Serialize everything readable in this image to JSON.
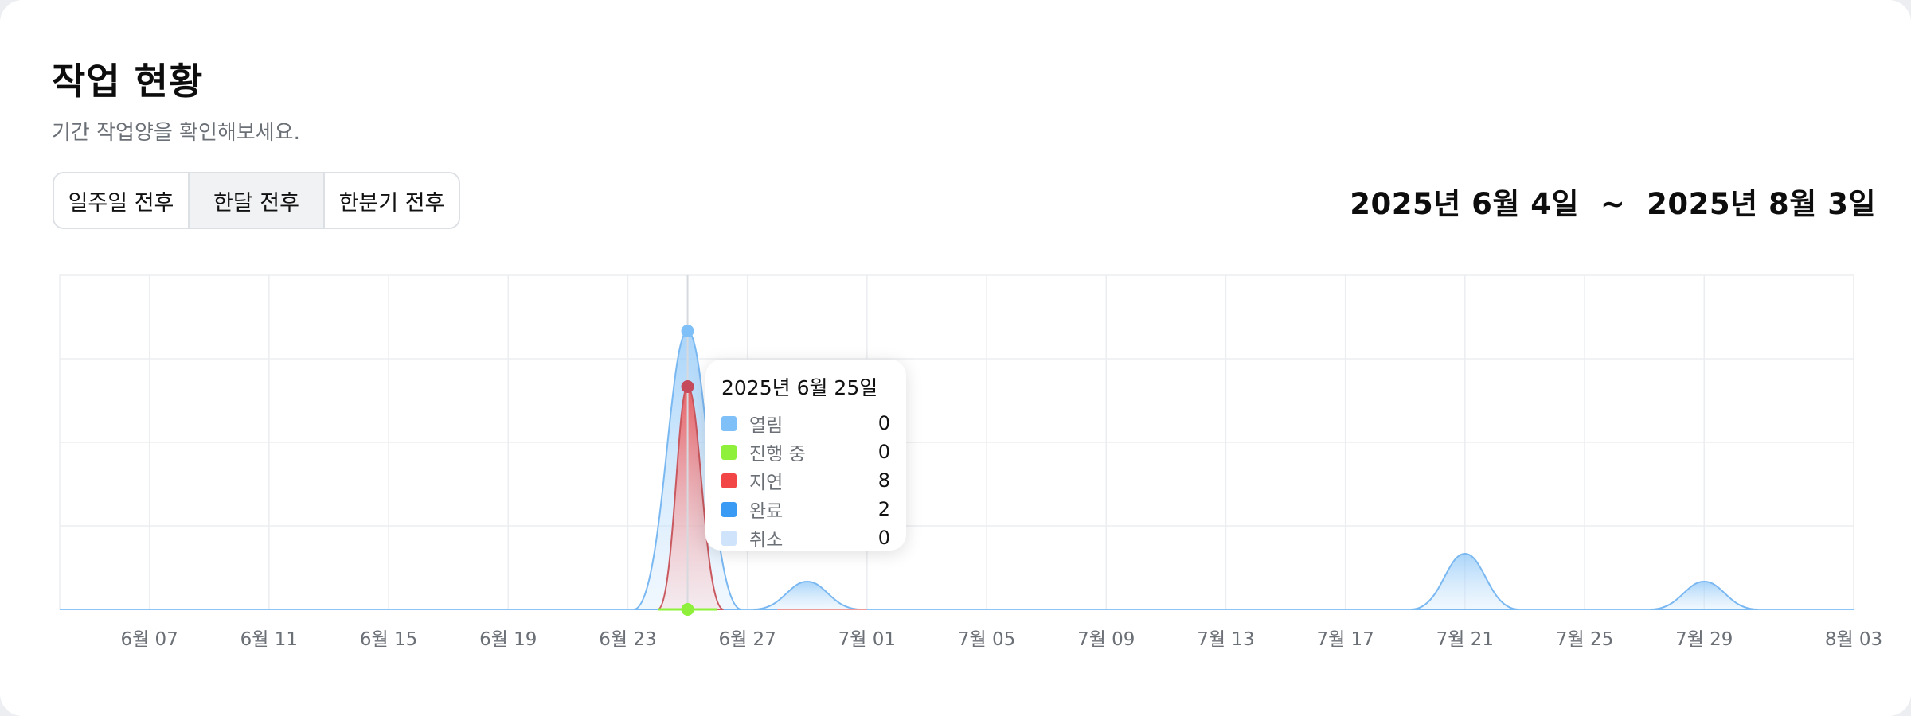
{
  "header": {
    "title": "작업 현황",
    "subtitle": "기간 작업양을 확인해보세요."
  },
  "period_tabs": [
    {
      "label": "일주일 전후",
      "active": false
    },
    {
      "label": "한달 전후",
      "active": true
    },
    {
      "label": "한분기 전후",
      "active": false
    }
  ],
  "date_range": {
    "start": "2025년 6월 4일",
    "separator": "~",
    "end": "2025년 8월 3일"
  },
  "tooltip": {
    "title": "2025년 6월 25일",
    "rows": [
      {
        "label": "열림",
        "value": "0",
        "color": "#7ec0f7"
      },
      {
        "label": "진행 중",
        "value": "0",
        "color": "#8ef03a"
      },
      {
        "label": "지연",
        "value": "8",
        "color": "#f24646"
      },
      {
        "label": "완료",
        "value": "2",
        "color": "#3a9bf5"
      },
      {
        "label": "취소",
        "value": "0",
        "color": "#cfe4fb"
      }
    ]
  },
  "chart_data": {
    "type": "area",
    "x_ticks": [
      "6월 07",
      "6월 11",
      "6월 15",
      "6월 19",
      "6월 23",
      "6월 27",
      "7월 01",
      "7월 05",
      "7월 09",
      "7월 13",
      "7월 17",
      "7월 21",
      "7월 25",
      "7월 29",
      "8월 03"
    ],
    "x_range": [
      "2025-06-04",
      "2025-08-03"
    ],
    "ylim": [
      0,
      12
    ],
    "grid": true,
    "hovered_date": "2025-06-25",
    "series": [
      {
        "name": "열림",
        "color": "#7ec0f7",
        "points": []
      },
      {
        "name": "진행 중",
        "color": "#8ef03a",
        "points": []
      },
      {
        "name": "지연",
        "color": "#f24646",
        "points": [
          {
            "date": "2025-06-25",
            "value": 8
          }
        ]
      },
      {
        "name": "완료",
        "color": "#3a9bf5",
        "points": [
          {
            "date": "2025-06-25",
            "value": 2
          },
          {
            "date": "2025-06-29",
            "value": 1
          },
          {
            "date": "2025-07-21",
            "value": 2
          },
          {
            "date": "2025-07-29",
            "value": 1
          }
        ]
      },
      {
        "name": "취소",
        "color": "#cfe4fb",
        "points": []
      }
    ]
  }
}
